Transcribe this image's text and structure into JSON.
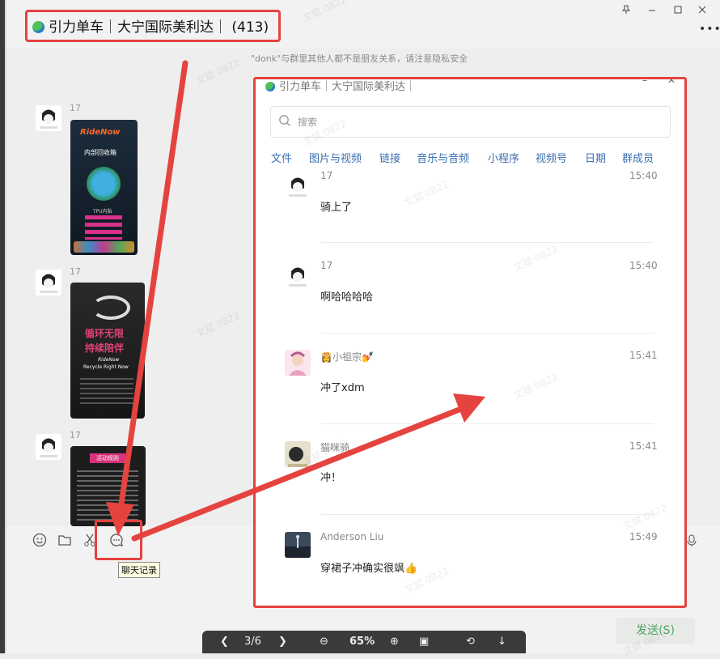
{
  "window": {
    "title": "引力单车｜大宁国际美利达｜ (413)",
    "controls": [
      "pin-icon",
      "minimize-icon",
      "maximize-icon",
      "close-icon"
    ],
    "more_label": "•••"
  },
  "notice": "\"donk\"与群里其他人都不是朋友关系，请注意隐私安全",
  "chat": {
    "messages": [
      {
        "sender": "17"
      },
      {
        "sender": "17"
      },
      {
        "sender": "17"
      }
    ]
  },
  "poster1": {
    "brand": "RideNow",
    "subtitle": "内部回收箱",
    "tag": "TPU内胎"
  },
  "poster2": {
    "brand": "RideNow",
    "line1": "循环无限",
    "line2": "持续陪伴",
    "line3": "Recycle Right Now"
  },
  "poster3": {
    "label": "活动规则"
  },
  "toolbar": {
    "tooltip": "聊天记录"
  },
  "send_label": "发送(S)",
  "viewer": {
    "page": "3/6",
    "zoom": "65%"
  },
  "history": {
    "title": "引力单车｜大宁国际美利达｜",
    "search_placeholder": "搜索",
    "tabs": [
      "文件",
      "图片与视频",
      "链接",
      "音乐与音频",
      "小程序",
      "视频号",
      "日期",
      "群成员"
    ],
    "messages": [
      {
        "name": "17",
        "time": "15:40",
        "text": "骑上了"
      },
      {
        "name": "17",
        "time": "15:40",
        "text": "啊哈哈哈哈"
      },
      {
        "name": "👸小祖宗💅",
        "time": "15:41",
        "text": "冲了xdm"
      },
      {
        "name": "猫咪骑…",
        "time": "15:41",
        "text": "冲！"
      },
      {
        "name": "Anderson Liu",
        "time": "15:49",
        "text": "穿裙子冲确实很飒👍"
      }
    ]
  },
  "watermark": "文斌 0822",
  "colors": {
    "highlight": "#e5433f",
    "send_text": "#4fa361",
    "tab_text": "#3b6fb0"
  }
}
